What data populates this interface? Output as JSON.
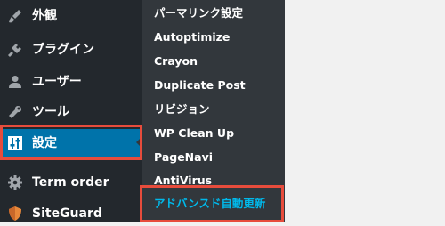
{
  "sidebar": {
    "items": [
      {
        "label": "外観",
        "icon": "paintbrush-icon"
      },
      {
        "label": "プラグイン",
        "icon": "plug-icon"
      },
      {
        "label": "ユーザー",
        "icon": "user-icon"
      },
      {
        "label": "ツール",
        "icon": "wrench-icon"
      },
      {
        "label": "設定",
        "icon": "settings-sliders-icon"
      },
      {
        "label": "Term order",
        "icon": "gear-icon"
      },
      {
        "label": "SiteGuard",
        "icon": "shield-icon"
      }
    ]
  },
  "submenu": {
    "items": [
      {
        "label": "パーマリンク設定"
      },
      {
        "label": "Autoptimize"
      },
      {
        "label": "Crayon"
      },
      {
        "label": "Duplicate Post"
      },
      {
        "label": "リビジョン"
      },
      {
        "label": "WP Clean Up"
      },
      {
        "label": "PageNavi"
      },
      {
        "label": "AntiVirus"
      },
      {
        "label": "アドバンスド自動更新"
      }
    ]
  },
  "colors": {
    "sidebar_bg": "#23282d",
    "submenu_bg": "#32373c",
    "current_bg": "#0073aa",
    "highlight_text": "#00b9eb",
    "annotation_red": "#e74c3c"
  }
}
